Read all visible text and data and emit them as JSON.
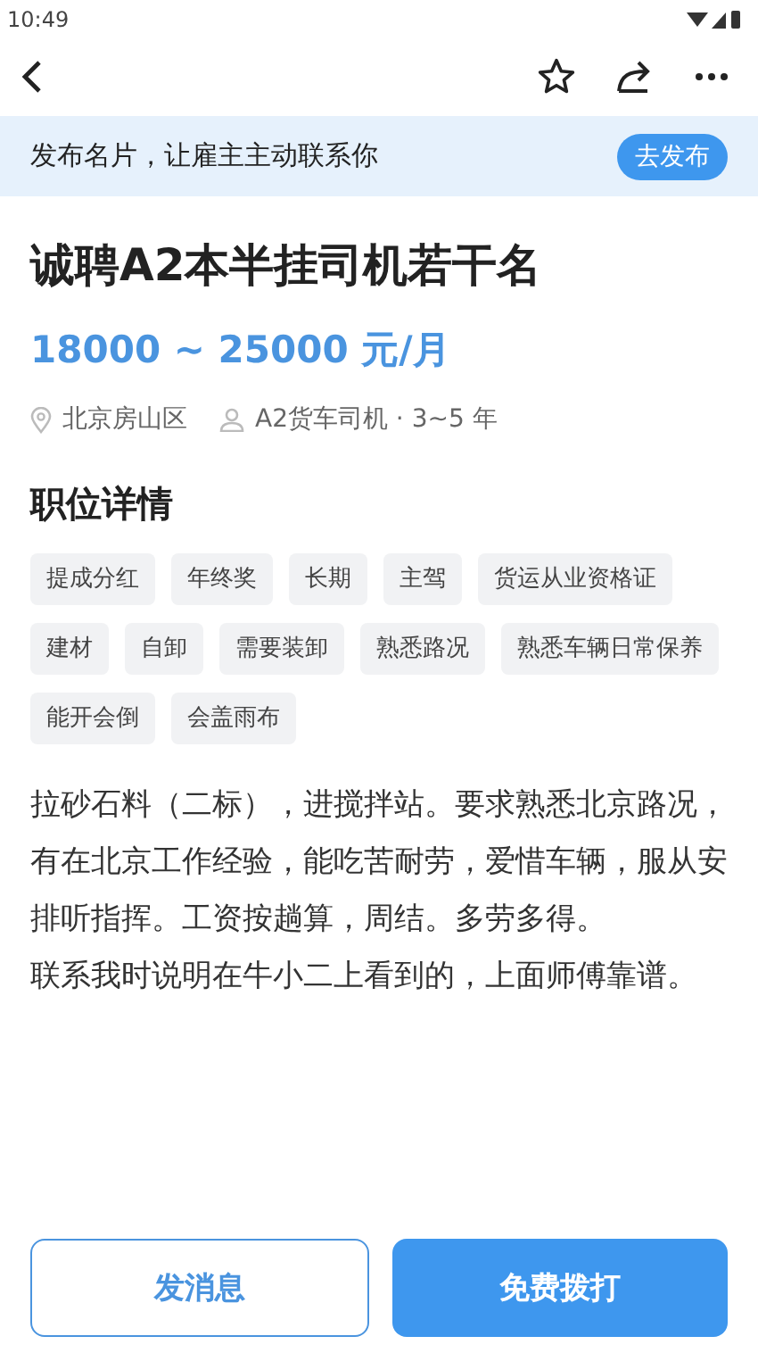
{
  "status_bar": {
    "time": "10:49"
  },
  "banner": {
    "text": "发布名片，让雇主主动联系你",
    "button": "去发布"
  },
  "job": {
    "title": "诚聘A2本半挂司机若干名",
    "salary": "18000 ~ 25000 元/月",
    "location": "北京房山区",
    "requirement": "A2货车司机 · 3~5 年"
  },
  "details": {
    "heading": "职位详情",
    "tags": [
      "提成分红",
      "年终奖",
      "长期",
      "主驾",
      "货运从业资格证",
      "建材",
      "自卸",
      "需要装卸",
      "熟悉路况",
      "熟悉车辆日常保养",
      "能开会倒",
      "会盖雨布"
    ],
    "description": [
      "拉砂石料（二标），进搅拌站。要求熟悉北京路况，有在北京工作经验，能吃苦耐劳，爱惜车辆，服从安排听指挥。工资按趟算，周结。多劳多得。",
      "联系我时说明在牛小二上看到的，上面师傅靠谱。"
    ]
  },
  "actions": [
    {
      "label": "发消息",
      "kind": "outline"
    },
    {
      "label": "免费拨打",
      "kind": "filled"
    }
  ]
}
